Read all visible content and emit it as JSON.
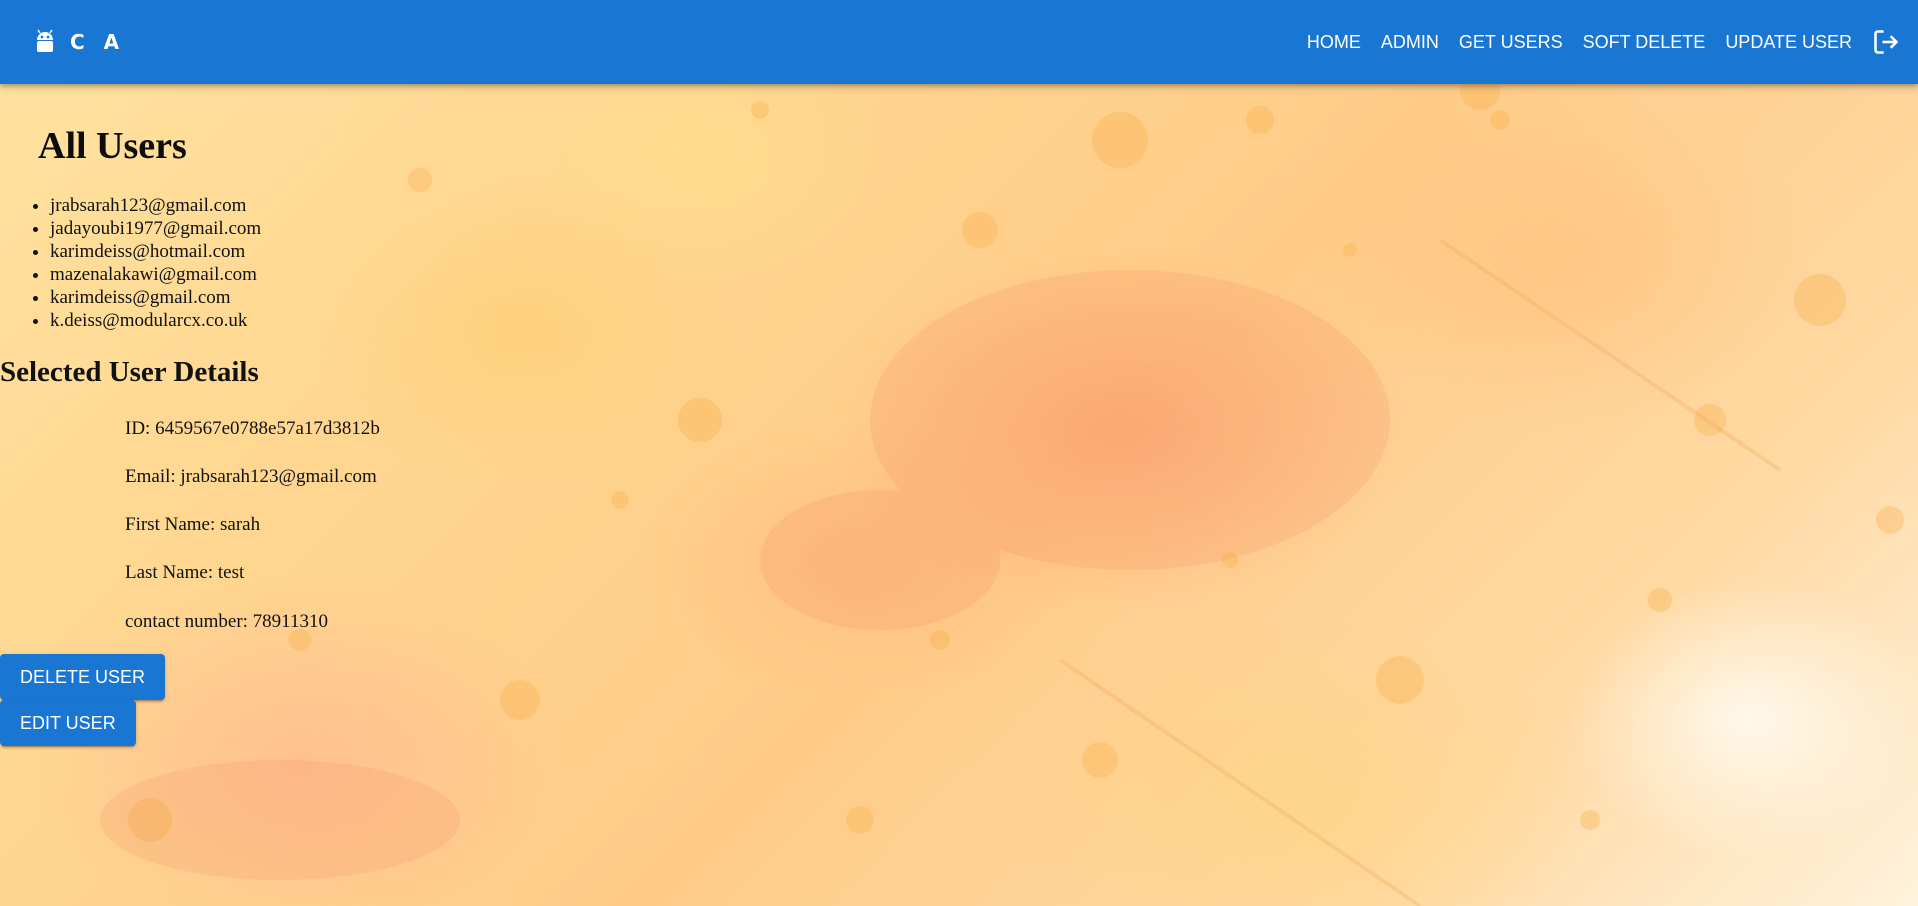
{
  "appbar": {
    "brand_text": "C A",
    "brand_icon": "android-icon",
    "nav": [
      {
        "label": "HOME"
      },
      {
        "label": "ADMIN"
      },
      {
        "label": "GET USERS"
      },
      {
        "label": "SOFT DELETE"
      },
      {
        "label": "UPDATE USER"
      }
    ],
    "logout_icon": "logout-icon",
    "color": "#1976d2"
  },
  "main": {
    "title": "All Users",
    "users": [
      "jrabsarah123@gmail.com",
      "jadayoubi1977@gmail.com",
      "karimdeiss@hotmail.com",
      "mazenalakawi@gmail.com",
      "karimdeiss@gmail.com",
      "k.deiss@modularcx.co.uk"
    ],
    "details_title": "Selected User Details",
    "details": {
      "id": "ID: 6459567e0788e57a17d3812b",
      "email": "Email: jrabsarah123@gmail.com",
      "first_name": "First Name: sarah",
      "last_name": "Last Name: test",
      "contact": "contact number: 78911310"
    },
    "buttons": {
      "delete": "DELETE USER",
      "edit": "EDIT USER"
    }
  }
}
